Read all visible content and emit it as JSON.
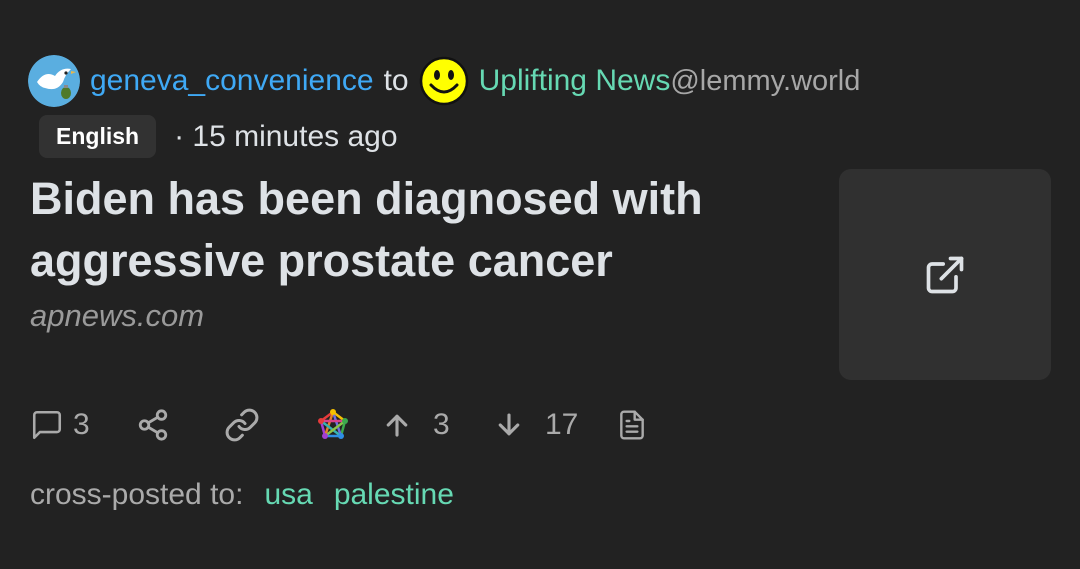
{
  "post": {
    "author": "geneva_convenience",
    "to_text": "to",
    "community": "Uplifting News",
    "instance": "@lemmy.world",
    "language": "English",
    "time_ago": "· 15 minutes ago",
    "title": "Biden has been diagnosed with aggressive prostate cancer",
    "domain": "apnews.com"
  },
  "actions": {
    "comments": "3",
    "upvotes": "3",
    "downvotes": "17"
  },
  "crosspost": {
    "label": "cross-posted to:",
    "communities": [
      "usa",
      "palestine"
    ]
  },
  "icons": {
    "author_avatar": "dove-with-grenade",
    "community_avatar": "smiley-face",
    "thumbnail": "external-link-icon",
    "comment": "comment-icon",
    "share": "share-icon",
    "link": "link-icon",
    "fediverse": "fediverse-icon",
    "upvote": "arrow-up-icon",
    "downvote": "arrow-down-icon",
    "source": "document-icon"
  },
  "colors": {
    "background": "#222222",
    "author": "#3fa9f5",
    "community": "#66d9b3",
    "muted": "#aaaaaa"
  }
}
